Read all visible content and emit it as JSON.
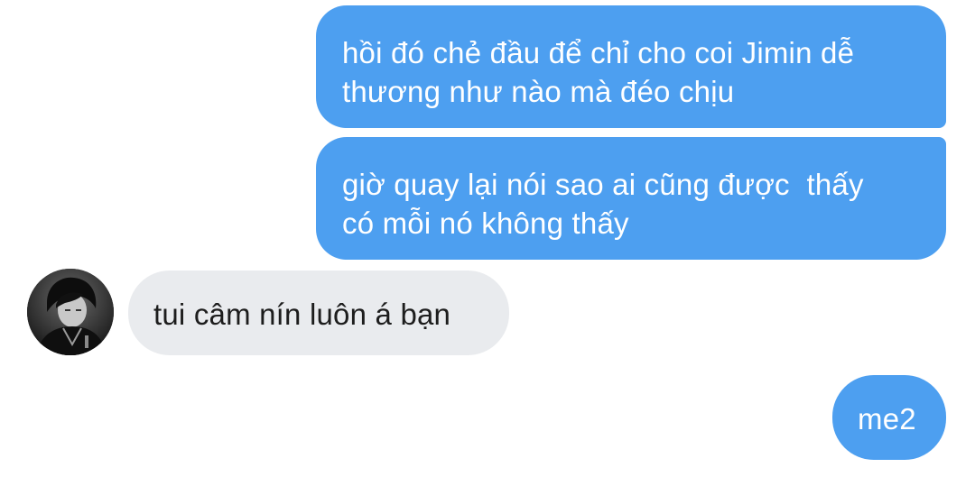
{
  "chat": {
    "messages": [
      {
        "direction": "outgoing",
        "lines": [
          "hồi đó chẻ đầu để chỉ cho coi Jimin dễ",
          "thương như nào mà đéo chịu"
        ]
      },
      {
        "direction": "outgoing",
        "lines": [
          "giờ quay lại nói sao ai cũng được  thấy",
          "có mỗi nó không thấy"
        ]
      },
      {
        "direction": "incoming",
        "lines": [
          "tui câm nín luôn á bạn"
        ]
      },
      {
        "direction": "outgoing",
        "lines": [
          "me2"
        ]
      }
    ],
    "contact_avatar": {
      "icon": "profile-photo-grayscale"
    }
  },
  "colors": {
    "outgoing_bubble": "#4d9ff0",
    "outgoing_text": "#ffffff",
    "incoming_bubble": "#e9ebee",
    "incoming_text": "#1d1d1d",
    "background": "#ffffff"
  }
}
